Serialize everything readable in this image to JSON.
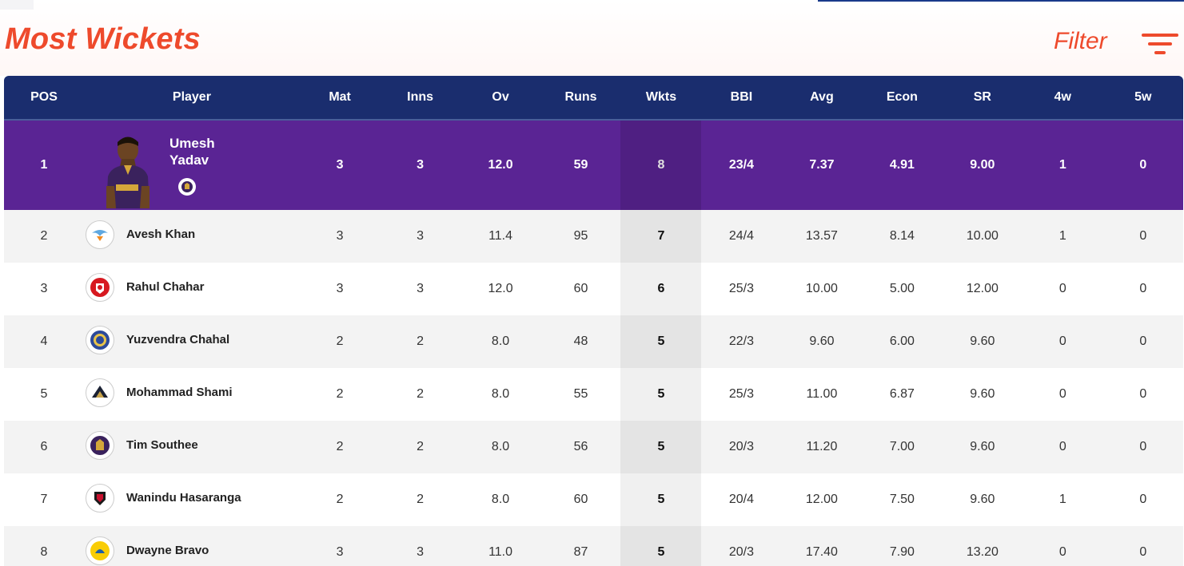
{
  "page": {
    "title": "Most Wickets",
    "filter_label": "Filter"
  },
  "columns": [
    "POS",
    "Player",
    "Mat",
    "Inns",
    "Ov",
    "Runs",
    "Wkts",
    "BBI",
    "Avg",
    "Econ",
    "SR",
    "4w",
    "5w"
  ],
  "rows": [
    {
      "pos": "1",
      "player": "Umesh Yadav",
      "team_icon": "kkr-logo-icon",
      "mat": "3",
      "inns": "3",
      "ov": "12.0",
      "runs": "59",
      "wkts": "8",
      "bbi": "23/4",
      "avg": "7.37",
      "econ": "4.91",
      "sr": "9.00",
      "four_w": "1",
      "five_w": "0"
    },
    {
      "pos": "2",
      "player": "Avesh Khan",
      "team_icon": "lsg-logo-icon",
      "mat": "3",
      "inns": "3",
      "ov": "11.4",
      "runs": "95",
      "wkts": "7",
      "bbi": "24/4",
      "avg": "13.57",
      "econ": "8.14",
      "sr": "10.00",
      "four_w": "1",
      "five_w": "0"
    },
    {
      "pos": "3",
      "player": "Rahul Chahar",
      "team_icon": "pbks-logo-icon",
      "mat": "3",
      "inns": "3",
      "ov": "12.0",
      "runs": "60",
      "wkts": "6",
      "bbi": "25/3",
      "avg": "10.00",
      "econ": "5.00",
      "sr": "12.00",
      "four_w": "0",
      "five_w": "0"
    },
    {
      "pos": "4",
      "player": "Yuzvendra Chahal",
      "team_icon": "rr-logo-icon",
      "mat": "2",
      "inns": "2",
      "ov": "8.0",
      "runs": "48",
      "wkts": "5",
      "bbi": "22/3",
      "avg": "9.60",
      "econ": "6.00",
      "sr": "9.60",
      "four_w": "0",
      "five_w": "0"
    },
    {
      "pos": "5",
      "player": "Mohammad Shami",
      "team_icon": "gt-logo-icon",
      "mat": "2",
      "inns": "2",
      "ov": "8.0",
      "runs": "55",
      "wkts": "5",
      "bbi": "25/3",
      "avg": "11.00",
      "econ": "6.87",
      "sr": "9.60",
      "four_w": "0",
      "five_w": "0"
    },
    {
      "pos": "6",
      "player": "Tim Southee",
      "team_icon": "kkr-logo-icon",
      "mat": "2",
      "inns": "2",
      "ov": "8.0",
      "runs": "56",
      "wkts": "5",
      "bbi": "20/3",
      "avg": "11.20",
      "econ": "7.00",
      "sr": "9.60",
      "four_w": "0",
      "five_w": "0"
    },
    {
      "pos": "7",
      "player": "Wanindu Hasaranga",
      "team_icon": "rcb-logo-icon",
      "mat": "2",
      "inns": "2",
      "ov": "8.0",
      "runs": "60",
      "wkts": "5",
      "bbi": "20/4",
      "avg": "12.00",
      "econ": "7.50",
      "sr": "9.60",
      "four_w": "1",
      "five_w": "0"
    },
    {
      "pos": "8",
      "player": "Dwayne Bravo",
      "team_icon": "csk-logo-icon",
      "mat": "3",
      "inns": "3",
      "ov": "11.0",
      "runs": "87",
      "wkts": "5",
      "bbi": "20/3",
      "avg": "17.40",
      "econ": "7.90",
      "sr": "13.20",
      "four_w": "0",
      "five_w": "0"
    }
  ],
  "colors": {
    "accent": "#ee4a2c",
    "header_bg": "#1a2d6e",
    "leader_row_bg": "#5a2494",
    "kkr": "#3a225d",
    "lsg": "#5fa8e0",
    "pbks": "#d71920",
    "rr": "#2d4a9a",
    "gt": "#1b2133",
    "rcb": "#c8102e",
    "csk": "#f9cd05"
  }
}
